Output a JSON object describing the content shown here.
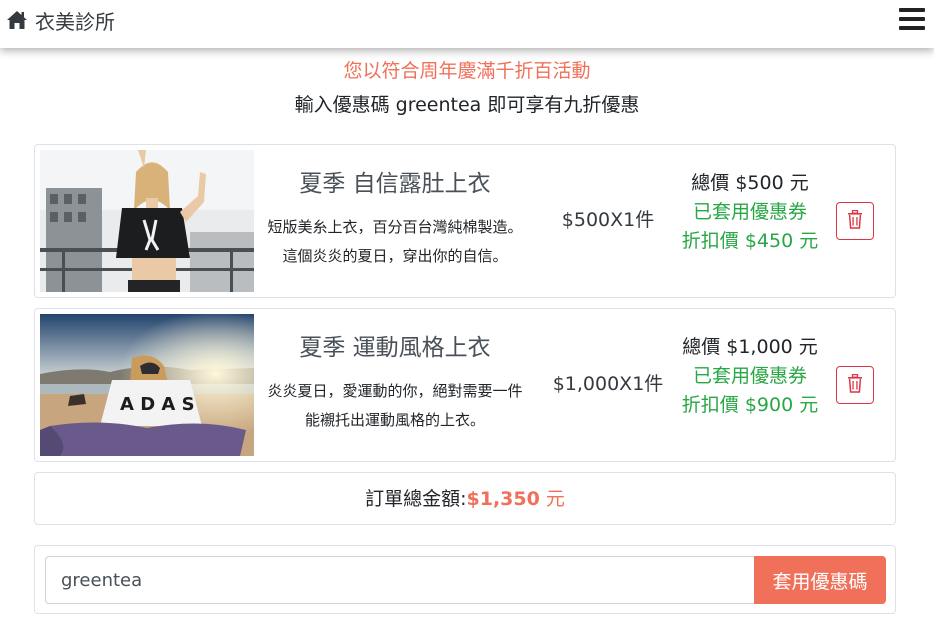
{
  "brand": {
    "icon": "home-icon",
    "name": "衣美診所"
  },
  "navbar": {
    "menu_icon": "hamburger-menu-icon"
  },
  "promo": {
    "line1": "您以符合周年慶滿千折百活動",
    "line2": "輸入優惠碼 greentea 即可享有九折優惠"
  },
  "cart": {
    "items": [
      {
        "image": "product-photo-woman-crop-top",
        "title": "夏季 自信露肚上衣",
        "desc_line1": "短版美糸上衣，百分百台灣純棉製造。",
        "desc_line2": "這個炎炎的夏日，穿出你的自信。",
        "qty": "$500X1件",
        "total": "總價 $500 元",
        "coupon_status": "已套用優惠券",
        "discount": "折扣價 $450 元",
        "delete_icon": "trash-icon"
      },
      {
        "image": "product-photo-beach-sport-shirt",
        "title": "夏季 運動風格上衣",
        "desc_line1": "炎炎夏日，愛運動的你，絕對需要一件",
        "desc_line2": "能襯托出運動風格的上衣。",
        "qty": "$1,000X1件",
        "total": "總價 $1,000 元",
        "coupon_status": "已套用優惠券",
        "discount": "折扣價 $900 元",
        "delete_icon": "trash-icon"
      }
    ]
  },
  "order": {
    "total_label": "訂單總金額:",
    "total_amount": "$1,350",
    "total_unit": " 元"
  },
  "coupon": {
    "input_value": "greentea",
    "button_label": "套用優惠碼"
  },
  "colors": {
    "accent": "#f0705a",
    "success": "#28a745",
    "danger": "#dc3545",
    "text": "#343a40"
  }
}
